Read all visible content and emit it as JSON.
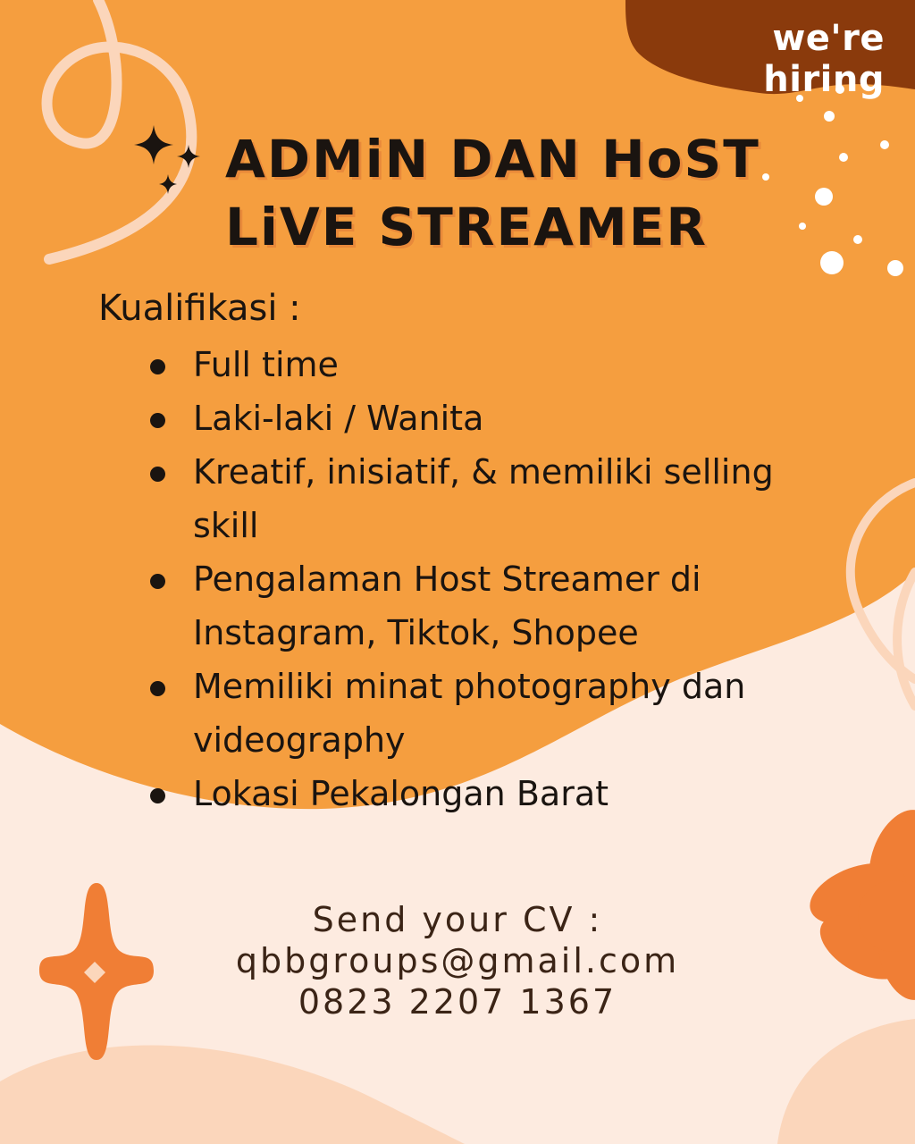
{
  "badge": {
    "text": "we're hiring"
  },
  "title": {
    "line1": "ADMiN DAN HoST",
    "line2": "LiVE STREAMER"
  },
  "qualifications": {
    "heading": "Kualifikasi :",
    "items": [
      "Full time",
      "Laki-laki / Wanita",
      "Kreatif, inisiatif, & memiliki selling skill",
      "Pengalaman Host Streamer di Instagram, Tiktok, Shopee",
      "Memiliki minat photography dan videography",
      "Lokasi Pekalongan Barat"
    ]
  },
  "contact": {
    "label": "Send your CV :",
    "email": "qbbgroups@gmail.com",
    "phone": "0823 2207 1367"
  },
  "colors": {
    "orange_blob": "#f59e3f",
    "brown_badge": "#8a3a0c",
    "peach_background": "#fdebe0",
    "accent_orange": "#f07e35",
    "text_dark": "#1a1410",
    "text_brown": "#3b2416"
  },
  "decorations": [
    "sparkle-icon",
    "flower-icon",
    "star-icon",
    "swirl-line",
    "confetti-dots"
  ]
}
